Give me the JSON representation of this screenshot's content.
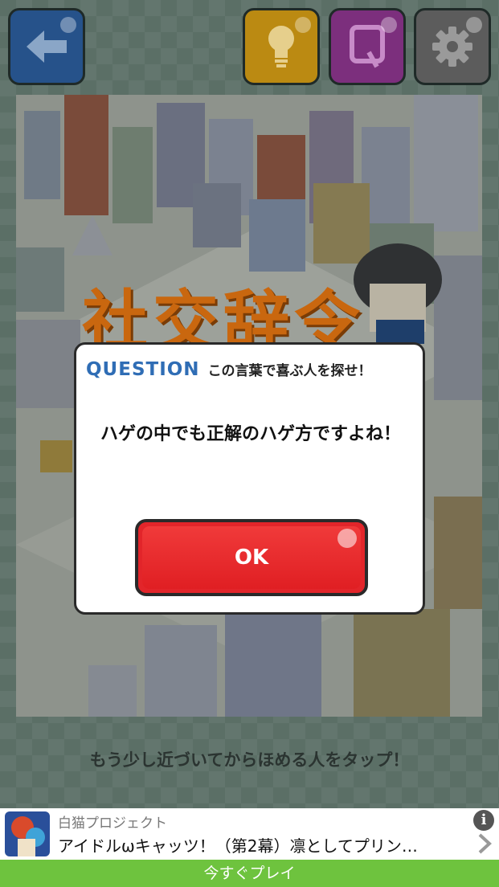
{
  "toolbar": {
    "back_icon": "arrow-left-icon",
    "hint_icon": "lightbulb-icon",
    "question_icon": "q-icon",
    "settings_icon": "gear-icon"
  },
  "scene": {
    "title": "社交辞令"
  },
  "dialog": {
    "tag": "QUESTION",
    "subtitle": "この言葉で喜ぶ人を探せ！",
    "message": "ハゲの中でも正解のハゲ方ですよね！",
    "ok_label": "OK"
  },
  "hint": "もう少し近づいてからほめる人をタップ！",
  "ad": {
    "app_name": "白猫プロジェクト",
    "title": "アイドルωキャッツ！（第2幕）凛としてプリン…",
    "info_icon": "info-icon",
    "chevron_icon": "chevron-right-icon",
    "cta": "今すぐプレイ"
  },
  "colors": {
    "question_tag": "#2f6db5",
    "ok_button": "#e2252a",
    "cta_bar": "#6ec33e",
    "title_orange": "#c9670f"
  }
}
